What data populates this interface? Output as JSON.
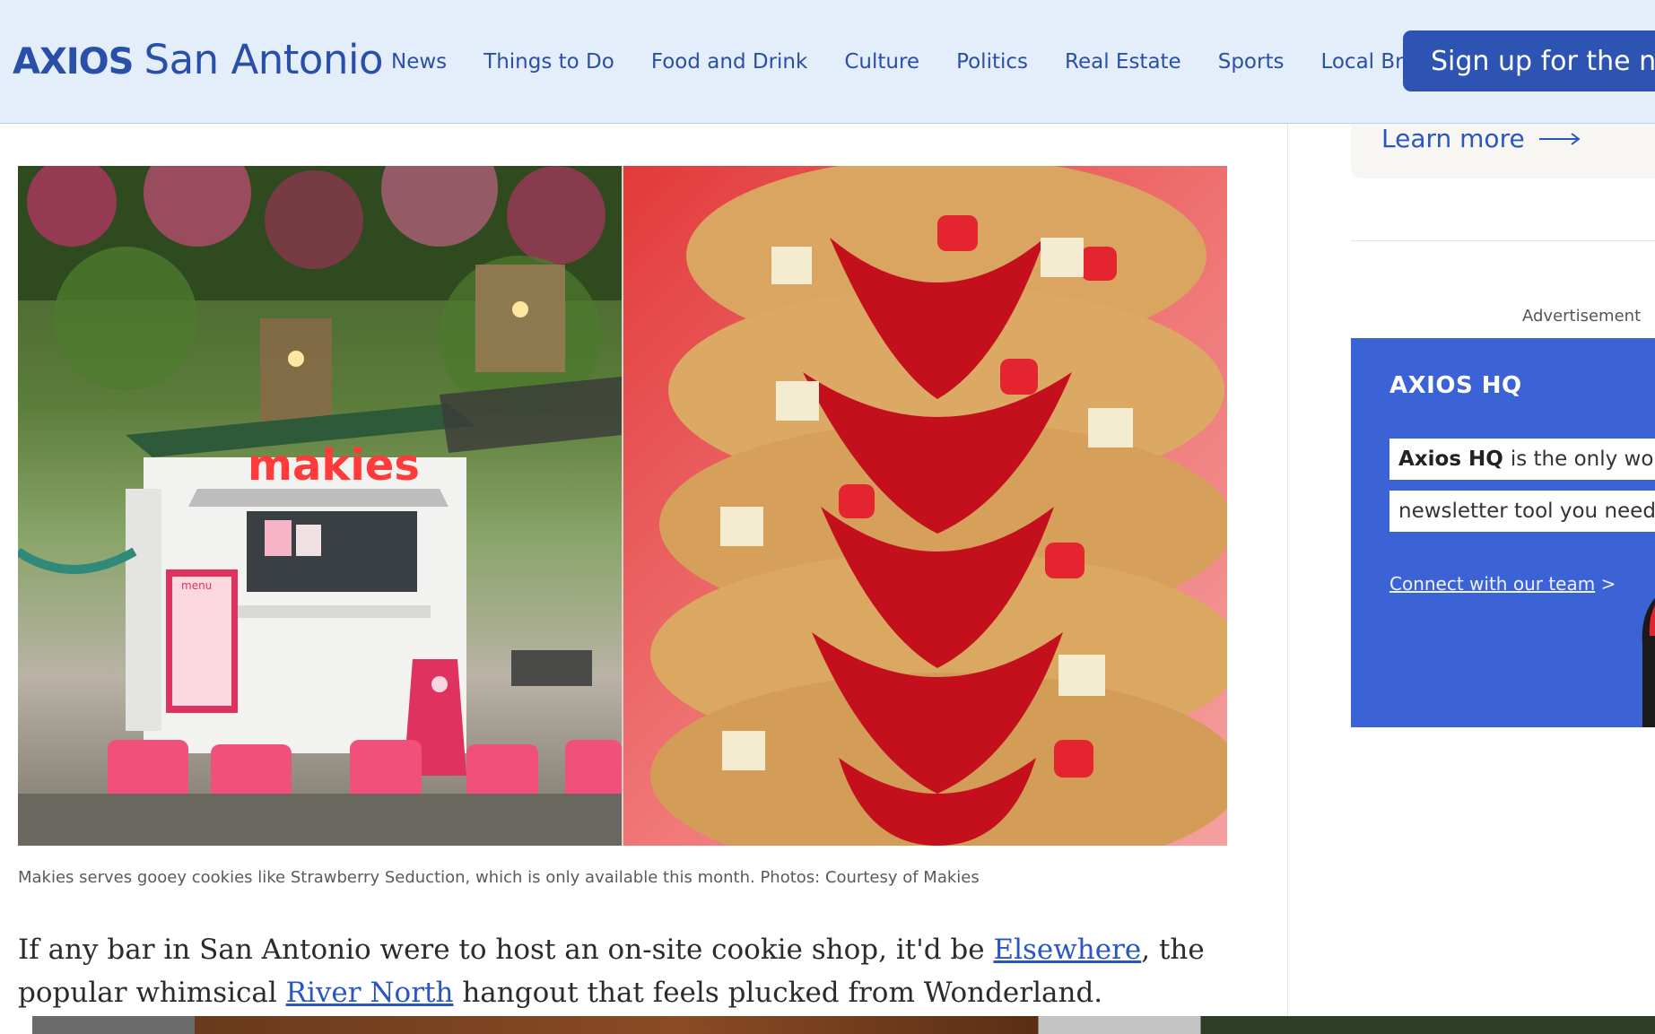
{
  "header": {
    "logo_mark": "AXIOS",
    "logo_city": "San Antonio",
    "nav": [
      "News",
      "Things to Do",
      "Food and Drink",
      "Culture",
      "Politics",
      "Real Estate",
      "Sports",
      "Local Brief"
    ],
    "signup_label": "Sign up for the ne"
  },
  "article": {
    "caption": "Makies serves gooey cookies like Strawberry Seduction, which is only available this month. Photos: Courtesy of Makies",
    "shop_sign": "makies",
    "menu_title": "menu",
    "paragraph": {
      "part1": "If any bar in San Antonio were to host an on-site cookie shop, it'd be ",
      "link1": "Elsewhere",
      "part2": ", the popular whimsical ",
      "link2": "River North",
      "part3": " hangout that feels plucked from Wonderland."
    }
  },
  "sidebar": {
    "learn_more": "Learn more",
    "ad_label": "Advertisement",
    "ad": {
      "logo": "AXIOS HQ",
      "line1_bold": "Axios HQ",
      "line1_rest": "is the only wor",
      "line2": "newsletter tool you need",
      "cta": "Connect with our team",
      "cta_arrow": ">"
    }
  },
  "colors": {
    "header_bg": "#e4eefb",
    "brand_blue": "#2a4fa8",
    "signup_bg": "#2d54b3",
    "link_blue": "#2a55c4",
    "ad_bg": "#3b63d6"
  }
}
